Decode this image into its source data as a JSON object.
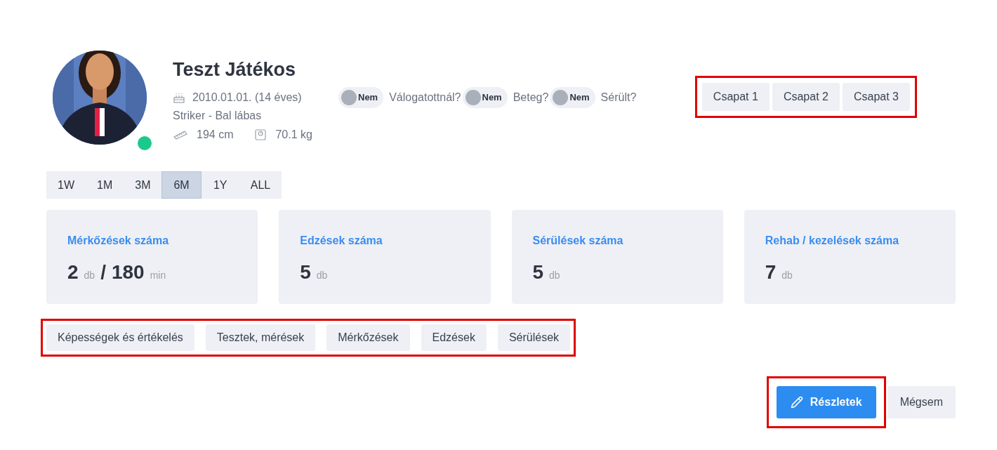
{
  "player": {
    "name": "Teszt Játékos",
    "birth": "2010.01.01. (14 éves)",
    "position": "Striker - Bal lábas",
    "height": "194 cm",
    "weight": "70.1 kg",
    "online": true
  },
  "toggles": [
    {
      "state_label": "Nem",
      "question": "Válogatottnál?",
      "on": false
    },
    {
      "state_label": "Nem",
      "question": "Beteg?",
      "on": false
    },
    {
      "state_label": "Nem",
      "question": "Sérült?",
      "on": false
    }
  ],
  "teams": {
    "highlighted": true,
    "buttons": [
      "Csapat 1",
      "Csapat 2",
      "Csapat 3"
    ]
  },
  "periods": [
    {
      "label": "1W",
      "selected": false
    },
    {
      "label": "1M",
      "selected": false
    },
    {
      "label": "3M",
      "selected": false
    },
    {
      "label": "6M",
      "selected": true
    },
    {
      "label": "1Y",
      "selected": false
    },
    {
      "label": "ALL",
      "selected": false
    }
  ],
  "stats": [
    {
      "title": "Mérkőzések száma",
      "parts": [
        {
          "kind": "number",
          "text": "2"
        },
        {
          "kind": "unit",
          "text": "db"
        },
        {
          "kind": "number",
          "text": "/"
        },
        {
          "kind": "number",
          "text": "180"
        },
        {
          "kind": "unit",
          "text": "min"
        }
      ]
    },
    {
      "title": "Edzések száma",
      "parts": [
        {
          "kind": "number",
          "text": "5"
        },
        {
          "kind": "unit",
          "text": "db"
        }
      ]
    },
    {
      "title": "Sérülések száma",
      "parts": [
        {
          "kind": "number",
          "text": "5"
        },
        {
          "kind": "unit",
          "text": "db"
        }
      ]
    },
    {
      "title": "Rehab / kezelések száma",
      "parts": [
        {
          "kind": "number",
          "text": "7"
        },
        {
          "kind": "unit",
          "text": "db"
        }
      ]
    }
  ],
  "sections": {
    "highlighted": true,
    "buttons": [
      "Képességek és értékelés",
      "Tesztek, mérések",
      "Mérkőzések",
      "Edzések",
      "Sérülések"
    ]
  },
  "actions": {
    "primary": {
      "label": "Részletek",
      "highlighted": true
    },
    "secondary": "Mégsem"
  }
}
